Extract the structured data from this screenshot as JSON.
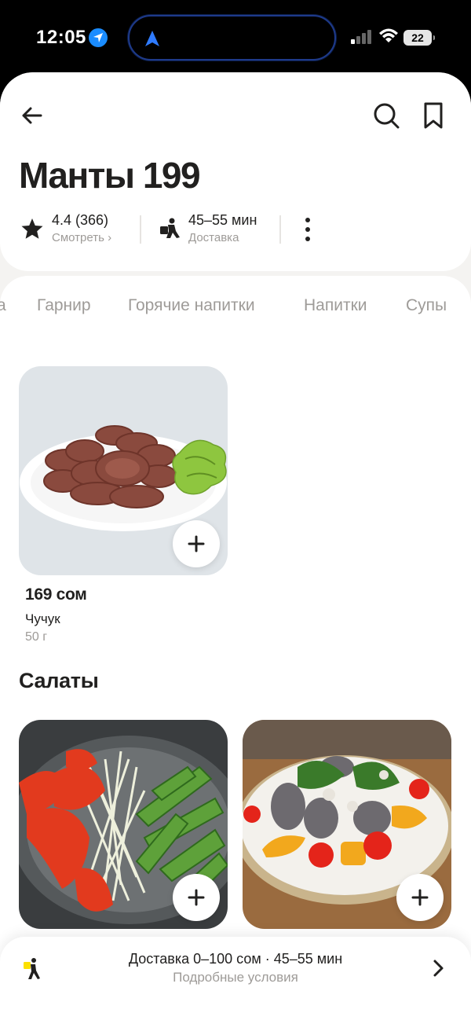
{
  "status_bar": {
    "time": "12:05",
    "battery": "22",
    "icons": [
      "location-arrow-icon",
      "navigation-arrow-icon",
      "signal-icon",
      "wifi-icon",
      "battery-icon"
    ]
  },
  "header": {
    "title": "Манты 199",
    "rating": "4.4 (366)",
    "rating_link": "Смотреть ›",
    "delivery_time": "45–55 мин",
    "delivery_label": "Доставка"
  },
  "tabs": [
    {
      "label": "а"
    },
    {
      "label": "Гарнир"
    },
    {
      "label": "Горячие напитки"
    },
    {
      "label": "Напитки"
    },
    {
      "label": "Супы"
    }
  ],
  "products": [
    {
      "price": "169 сом",
      "name": "Чучук",
      "weight": "50 г"
    }
  ],
  "sections": [
    {
      "title": "Салаты"
    }
  ],
  "bottom_bar": {
    "main": "Доставка 0–100 сом · 45–55 мин",
    "sub": "Подробные условия"
  },
  "colors": {
    "text": "#21201f",
    "muted": "#9e9b98",
    "island_border": "#1e3a8a",
    "location_blue": "#1a8cff"
  }
}
